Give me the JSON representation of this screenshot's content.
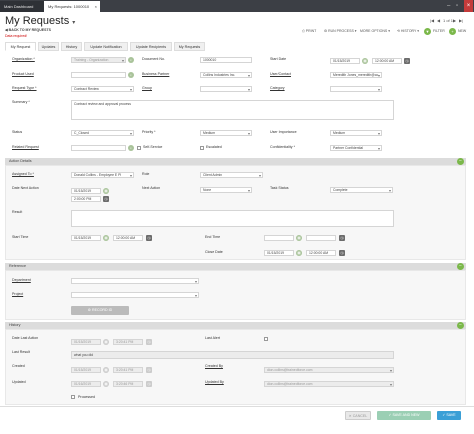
{
  "window": {
    "tabs": [
      {
        "label": "Main Dashboard"
      },
      {
        "label": "My Requests: 1000010"
      }
    ],
    "tab_close": "×",
    "minimize": "–",
    "maximize": "▫",
    "close": "×"
  },
  "header": {
    "title": "My Requests",
    "title_caret": "▾",
    "back_label": "BACK TO MY REQUESTS",
    "required_note": "Data required!",
    "pager": "1 of 1",
    "pager_first": "|◀",
    "pager_prev": "◀",
    "pager_next": "▶",
    "pager_last": "▶|"
  },
  "toolbar": {
    "print": "PRINT",
    "run_process": "RUN PROCESS",
    "more_options": "MORE OPTIONS",
    "history": "HISTORY",
    "filter": "FILTER",
    "new": "NEW"
  },
  "subtabs": [
    "My Request",
    "Updates",
    "History",
    "Update Notification",
    "Update Recipients",
    "My Requests"
  ],
  "main": {
    "organization_label": "Organization *",
    "organization_value": "Training - Organization",
    "document_no_label": "Document No.",
    "document_no_value": "1000010",
    "start_date_label": "Start Date",
    "start_date_value": "01/15/2019",
    "start_time_value": "12:00:00 AM",
    "product_used_label": "Product Used",
    "business_partner_label": "Business Partner",
    "business_partner_value": "Collins Industries Inc.",
    "user_contact_label": "User/Contact",
    "user_contact_value": "Meredith Jones_meredith@co",
    "request_type_label": "Request Type *",
    "request_type_value": "Contract Review",
    "group_label": "Group",
    "category_label": "Category",
    "summary_label": "Summary *",
    "summary_value": "Contract review and approval process",
    "status_label": "Status",
    "status_value": "C_Closed",
    "priority_label": "Priority *",
    "priority_value": "Medium",
    "user_importance_label": "User Importance",
    "user_importance_value": "Medium",
    "related_request_label": "Related Request",
    "self_service_label": "Self-Service",
    "escalated_label": "Escalated",
    "confidentiality_label": "Confidentiality *",
    "confidentiality_value": "Partner Confidential"
  },
  "action": {
    "section_title": "Action Details",
    "toggle": "−",
    "assigned_to_label": "Assigned To *",
    "assigned_to_value": "Donald Collins - Employee E Pl",
    "role_label": "Role",
    "role_value": "Client Admin",
    "date_next_action_label": "Date Next Action",
    "date_next_action_value": "01/15/2019",
    "date_next_action_time": "2:00:00 PM",
    "next_action_label": "Next Action",
    "next_action_value": "None",
    "task_status_label": "Task Status",
    "task_status_value": "Complete",
    "result_label": "Result",
    "start_time_label": "Start Time",
    "start_time_date": "01/15/2019",
    "start_time_time": "12:00:00 AM",
    "end_time_label": "End Time",
    "close_date_label": "Close Date",
    "close_date_value": "01/15/2019",
    "close_date_time": "12:00:00 AM"
  },
  "reference": {
    "section_title": "Reference",
    "toggle": "−",
    "department_label": "Department",
    "project_label": "Project",
    "record_id_label": "RECORD ID"
  },
  "history": {
    "section_title": "History",
    "toggle": "−",
    "date_last_action_label": "Date Last Action",
    "date_last_action_value": "01/15/2019",
    "date_last_action_time": "3:20:41 PM",
    "last_alert_label": "Last Alert",
    "last_result_label": "Last Result",
    "last_result_value": "what you did",
    "created_label": "Created",
    "created_date": "01/15/2019",
    "created_time": "3:20:41 PM",
    "created_by_label": "Created By",
    "created_by_value": "dion.collins@trainedforce.com",
    "updated_label": "Updated",
    "updated_date": "01/16/2019",
    "updated_time": "3:20:46 PM",
    "updated_by_label": "Updated By",
    "updated_by_value": "dion.collins@trainedforce.com",
    "processed_label": "Processed"
  },
  "footer": {
    "cancel": "CANCEL",
    "save_and_new": "SAVE AND NEW",
    "save": "SAVE"
  }
}
